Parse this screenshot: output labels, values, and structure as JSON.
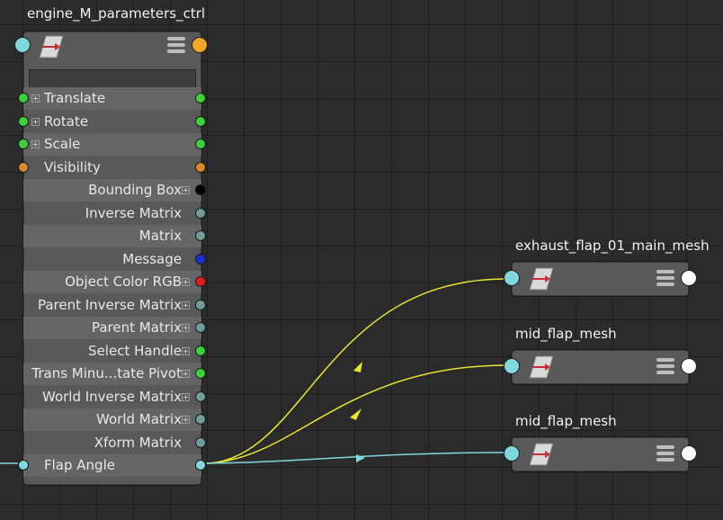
{
  "main_node": {
    "title": "engine_M_parameters_ctrl",
    "attributes": [
      {
        "label": "Translate",
        "align": "left",
        "expandable": true,
        "left_port": "#3cd13c",
        "right_port": "#3cd13c"
      },
      {
        "label": "Rotate",
        "align": "left",
        "expandable": true,
        "left_port": "#3cd13c",
        "right_port": "#3cd13c"
      },
      {
        "label": "Scale",
        "align": "left",
        "expandable": true,
        "left_port": "#3cd13c",
        "right_port": "#3cd13c"
      },
      {
        "label": "Visibility",
        "align": "left",
        "expandable": false,
        "left_port": "#d88a2a",
        "right_port": "#d88a2a"
      },
      {
        "label": "Bounding Box",
        "align": "right",
        "expandable": true,
        "left_port": null,
        "right_port": "#000000"
      },
      {
        "label": "Inverse Matrix",
        "align": "right",
        "expandable": false,
        "left_port": null,
        "right_port": "#6f9c9c"
      },
      {
        "label": "Matrix",
        "align": "right",
        "expandable": false,
        "left_port": null,
        "right_port": "#6f9c9c"
      },
      {
        "label": "Message",
        "align": "right",
        "expandable": false,
        "left_port": null,
        "right_port": "#1c2fcf"
      },
      {
        "label": "Object Color RGB",
        "align": "right",
        "expandable": true,
        "left_port": null,
        "right_port": "#e01e1e"
      },
      {
        "label": "Parent Inverse Matrix",
        "align": "right",
        "expandable": true,
        "left_port": null,
        "right_port": "#6f9c9c"
      },
      {
        "label": "Parent Matrix",
        "align": "right",
        "expandable": true,
        "left_port": null,
        "right_port": "#6f9c9c"
      },
      {
        "label": "Select Handle",
        "align": "right",
        "expandable": true,
        "left_port": null,
        "right_port": "#3cd13c"
      },
      {
        "label": "Trans Minu...tate Pivot",
        "align": "right",
        "expandable": true,
        "left_port": null,
        "right_port": "#3cd13c"
      },
      {
        "label": "World Inverse Matrix",
        "align": "right",
        "expandable": true,
        "left_port": null,
        "right_port": "#6f9c9c"
      },
      {
        "label": "World Matrix",
        "align": "right",
        "expandable": true,
        "left_port": null,
        "right_port": "#6f9c9c"
      },
      {
        "label": "Xform Matrix",
        "align": "right",
        "expandable": false,
        "left_port": null,
        "right_port": "#6f9c9c"
      },
      {
        "label": "Flap Angle",
        "align": "left",
        "expandable": false,
        "left_port": "#7fd8e0",
        "right_port": "#7fd8e0"
      }
    ]
  },
  "target_nodes": [
    {
      "title": "exhaust_flap_01_main_mesh"
    },
    {
      "title": "mid_flap_mesh"
    },
    {
      "title": "mid_flap_mesh"
    }
  ],
  "colors": {
    "node_bg": "#595959",
    "row_alt": "#656565",
    "input_port_header": "#7fd8e0",
    "output_port_header": "#f5a623",
    "target_out_port": "#ffffff",
    "wire_yellow": "#e6e632",
    "wire_cyan": "#7fd8e0"
  },
  "icons": {
    "node_type": "transform-node-icon",
    "menu": "hamburger-menu-icon"
  }
}
